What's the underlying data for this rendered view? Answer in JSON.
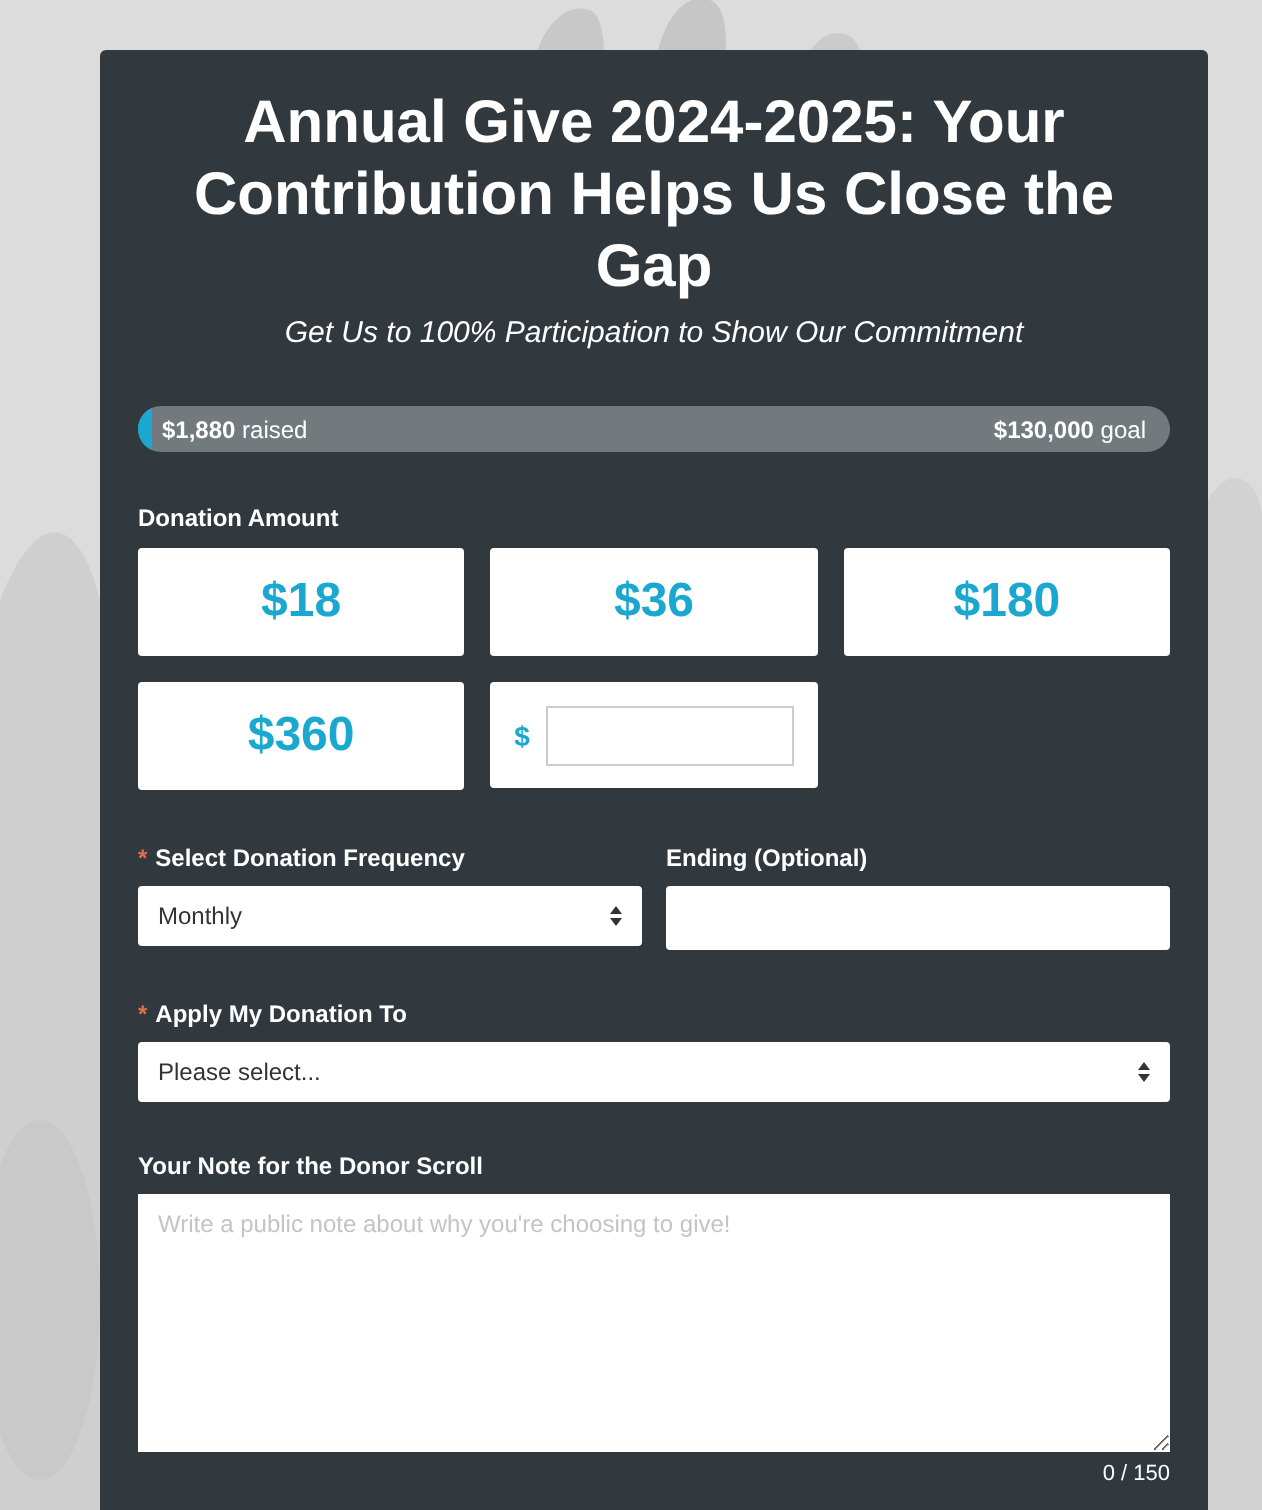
{
  "form": {
    "title": "Annual Give 2024-2025: Your Contribution Helps Us Close the Gap",
    "subtitle": "Get Us to 100% Participation to Show Our Commitment",
    "progress": {
      "raised": "**$1,880** raised",
      "goal": "**$130,000** goal",
      "level": 0.0145
    },
    "amount_label": "Donation Amount",
    "amounts": [
      {
        "kind": "preset",
        "label": "$18",
        "selected": false
      },
      {
        "kind": "preset",
        "label": "$36",
        "selected": false
      },
      {
        "kind": "preset",
        "label": "$180",
        "selected": false
      },
      {
        "kind": "preset",
        "label": "$360",
        "selected": false
      },
      {
        "kind": "custom",
        "label": "$",
        "selected": false
      }
    ],
    "frequency": {
      "required_mark": "*",
      "label": "Select Donation Frequency",
      "value": "Monthly"
    },
    "ending": {
      "label": "Ending (Optional)"
    },
    "designation": {
      "required_mark": "*",
      "label": "Apply My Donation To",
      "value": "Please select..."
    },
    "note": {
      "label": "Your Note for the Donor Scroll",
      "placeholder": "Write a public note about why you're choosing to give!",
      "counter": "0 / 150"
    }
  }
}
